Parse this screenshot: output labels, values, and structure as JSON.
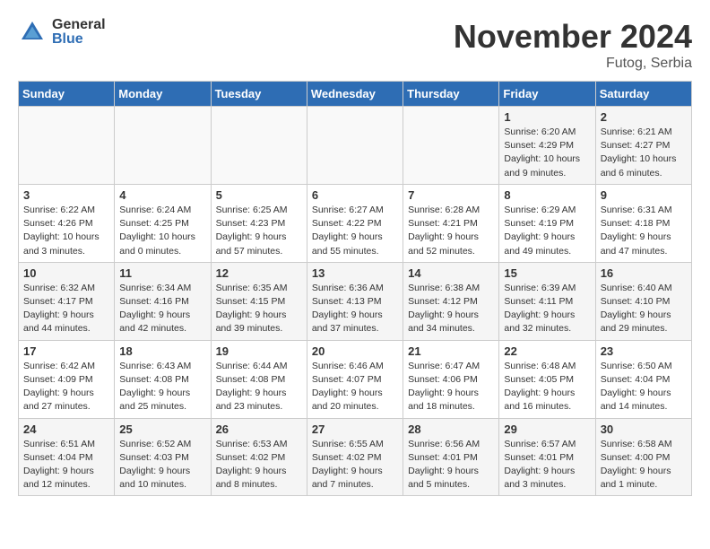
{
  "header": {
    "logo_general": "General",
    "logo_blue": "Blue",
    "month_title": "November 2024",
    "location": "Futog, Serbia"
  },
  "calendar": {
    "weekdays": [
      "Sunday",
      "Monday",
      "Tuesday",
      "Wednesday",
      "Thursday",
      "Friday",
      "Saturday"
    ],
    "weeks": [
      [
        {
          "day": "",
          "info": ""
        },
        {
          "day": "",
          "info": ""
        },
        {
          "day": "",
          "info": ""
        },
        {
          "day": "",
          "info": ""
        },
        {
          "day": "",
          "info": ""
        },
        {
          "day": "1",
          "info": "Sunrise: 6:20 AM\nSunset: 4:29 PM\nDaylight: 10 hours\nand 9 minutes."
        },
        {
          "day": "2",
          "info": "Sunrise: 6:21 AM\nSunset: 4:27 PM\nDaylight: 10 hours\nand 6 minutes."
        }
      ],
      [
        {
          "day": "3",
          "info": "Sunrise: 6:22 AM\nSunset: 4:26 PM\nDaylight: 10 hours\nand 3 minutes."
        },
        {
          "day": "4",
          "info": "Sunrise: 6:24 AM\nSunset: 4:25 PM\nDaylight: 10 hours\nand 0 minutes."
        },
        {
          "day": "5",
          "info": "Sunrise: 6:25 AM\nSunset: 4:23 PM\nDaylight: 9 hours\nand 57 minutes."
        },
        {
          "day": "6",
          "info": "Sunrise: 6:27 AM\nSunset: 4:22 PM\nDaylight: 9 hours\nand 55 minutes."
        },
        {
          "day": "7",
          "info": "Sunrise: 6:28 AM\nSunset: 4:21 PM\nDaylight: 9 hours\nand 52 minutes."
        },
        {
          "day": "8",
          "info": "Sunrise: 6:29 AM\nSunset: 4:19 PM\nDaylight: 9 hours\nand 49 minutes."
        },
        {
          "day": "9",
          "info": "Sunrise: 6:31 AM\nSunset: 4:18 PM\nDaylight: 9 hours\nand 47 minutes."
        }
      ],
      [
        {
          "day": "10",
          "info": "Sunrise: 6:32 AM\nSunset: 4:17 PM\nDaylight: 9 hours\nand 44 minutes."
        },
        {
          "day": "11",
          "info": "Sunrise: 6:34 AM\nSunset: 4:16 PM\nDaylight: 9 hours\nand 42 minutes."
        },
        {
          "day": "12",
          "info": "Sunrise: 6:35 AM\nSunset: 4:15 PM\nDaylight: 9 hours\nand 39 minutes."
        },
        {
          "day": "13",
          "info": "Sunrise: 6:36 AM\nSunset: 4:13 PM\nDaylight: 9 hours\nand 37 minutes."
        },
        {
          "day": "14",
          "info": "Sunrise: 6:38 AM\nSunset: 4:12 PM\nDaylight: 9 hours\nand 34 minutes."
        },
        {
          "day": "15",
          "info": "Sunrise: 6:39 AM\nSunset: 4:11 PM\nDaylight: 9 hours\nand 32 minutes."
        },
        {
          "day": "16",
          "info": "Sunrise: 6:40 AM\nSunset: 4:10 PM\nDaylight: 9 hours\nand 29 minutes."
        }
      ],
      [
        {
          "day": "17",
          "info": "Sunrise: 6:42 AM\nSunset: 4:09 PM\nDaylight: 9 hours\nand 27 minutes."
        },
        {
          "day": "18",
          "info": "Sunrise: 6:43 AM\nSunset: 4:08 PM\nDaylight: 9 hours\nand 25 minutes."
        },
        {
          "day": "19",
          "info": "Sunrise: 6:44 AM\nSunset: 4:08 PM\nDaylight: 9 hours\nand 23 minutes."
        },
        {
          "day": "20",
          "info": "Sunrise: 6:46 AM\nSunset: 4:07 PM\nDaylight: 9 hours\nand 20 minutes."
        },
        {
          "day": "21",
          "info": "Sunrise: 6:47 AM\nSunset: 4:06 PM\nDaylight: 9 hours\nand 18 minutes."
        },
        {
          "day": "22",
          "info": "Sunrise: 6:48 AM\nSunset: 4:05 PM\nDaylight: 9 hours\nand 16 minutes."
        },
        {
          "day": "23",
          "info": "Sunrise: 6:50 AM\nSunset: 4:04 PM\nDaylight: 9 hours\nand 14 minutes."
        }
      ],
      [
        {
          "day": "24",
          "info": "Sunrise: 6:51 AM\nSunset: 4:04 PM\nDaylight: 9 hours\nand 12 minutes."
        },
        {
          "day": "25",
          "info": "Sunrise: 6:52 AM\nSunset: 4:03 PM\nDaylight: 9 hours\nand 10 minutes."
        },
        {
          "day": "26",
          "info": "Sunrise: 6:53 AM\nSunset: 4:02 PM\nDaylight: 9 hours\nand 8 minutes."
        },
        {
          "day": "27",
          "info": "Sunrise: 6:55 AM\nSunset: 4:02 PM\nDaylight: 9 hours\nand 7 minutes."
        },
        {
          "day": "28",
          "info": "Sunrise: 6:56 AM\nSunset: 4:01 PM\nDaylight: 9 hours\nand 5 minutes."
        },
        {
          "day": "29",
          "info": "Sunrise: 6:57 AM\nSunset: 4:01 PM\nDaylight: 9 hours\nand 3 minutes."
        },
        {
          "day": "30",
          "info": "Sunrise: 6:58 AM\nSunset: 4:00 PM\nDaylight: 9 hours\nand 1 minute."
        }
      ]
    ]
  }
}
